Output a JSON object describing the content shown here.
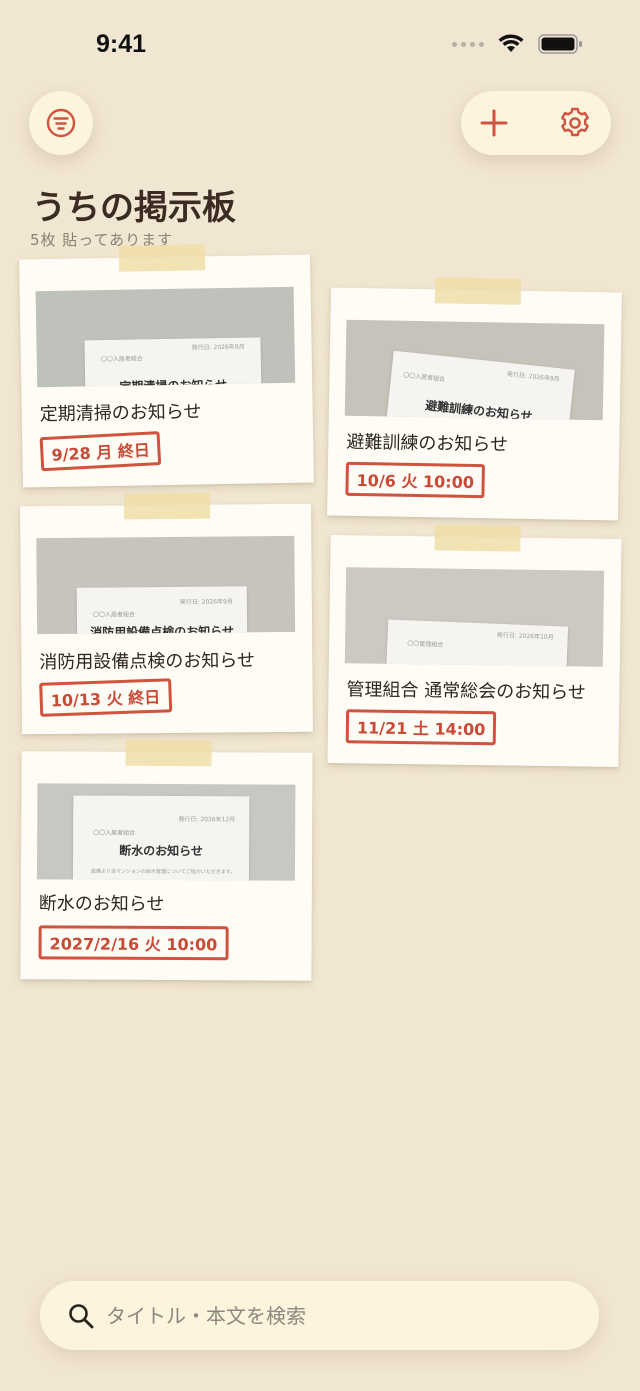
{
  "status_bar": {
    "time": "9:41"
  },
  "header": {
    "title": "うちの掲示板",
    "subtitle": "5枚 貼ってあります"
  },
  "notices": [
    {
      "title": "定期清掃のお知らせ",
      "date": "9/28 月 終日",
      "doc_heading": "定期清掃のお知らせ",
      "doc_org": "〇〇入居者組合",
      "doc_date": "発行日: 2026年9月"
    },
    {
      "title": "避難訓練のお知らせ",
      "date": "10/6 火 10:00",
      "doc_heading": "避難訓練のお知らせ",
      "doc_org": "〇〇入居者組合",
      "doc_date": "発行日: 2026年9月"
    },
    {
      "title": "消防用設備点検のお知らせ",
      "date": "10/13 火 終日",
      "doc_heading": "消防用設備点検のお知らせ",
      "doc_org": "〇〇入居者組合",
      "doc_date": "発行日: 2026年9月"
    },
    {
      "title": "管理組合 通常総会のお知らせ",
      "date": "11/21 土 14:00",
      "doc_heading": "",
      "doc_org": "〇〇管理組合",
      "doc_date": "発行日: 2026年10月"
    },
    {
      "title": "断水のお知らせ",
      "date": "2027/2/16 火 10:00",
      "doc_heading": "断水のお知らせ",
      "doc_org": "〇〇入居者組合",
      "doc_date": "発行日: 2026年12月",
      "doc_body": "設備より当マンションの給水管理についてご協力いただきます。"
    }
  ],
  "search": {
    "placeholder": "タイトル・本文を検索"
  },
  "colors": {
    "background": "#f1e6d1",
    "accent": "#d0533f",
    "button_bg": "#fcf4dd"
  },
  "icons": {
    "filter": "filter-icon",
    "add": "plus-icon",
    "settings": "gear-icon",
    "search": "search-icon"
  }
}
